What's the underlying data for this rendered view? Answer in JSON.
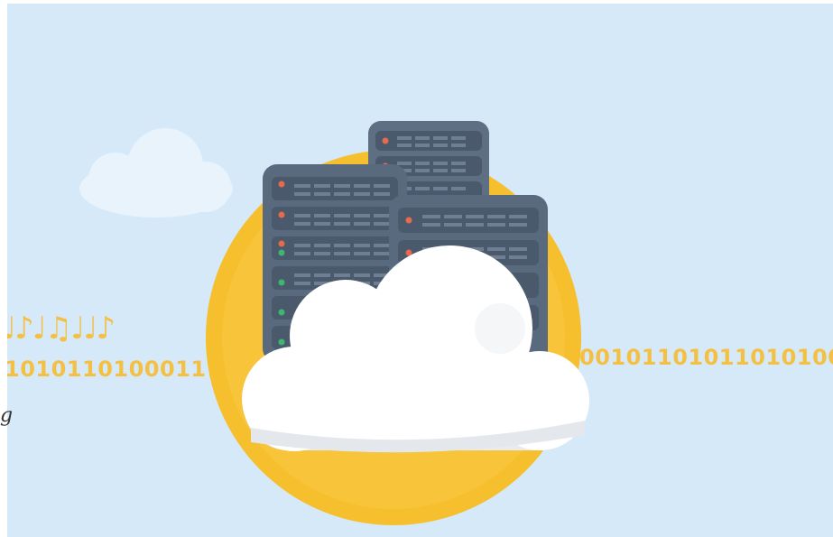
{
  "scene": {
    "left_digits": "1010110100011",
    "right_digits": "00101101011010100",
    "music_notes": "♩♪♩♫♩♩♪",
    "side_glyph": "g",
    "colors": {
      "sky": "#d6e9f8",
      "sun": "#f5bf2d",
      "server": "#556579",
      "cloud": "#ffffff",
      "data_stream": "#f4c044"
    }
  }
}
